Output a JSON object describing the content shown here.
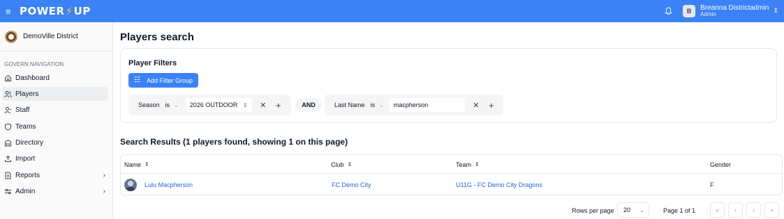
{
  "app": {
    "logo_left": "POWER",
    "logo_bolt": "⚡",
    "logo_right": "UP",
    "brand_color": "#3b82f6"
  },
  "user": {
    "initial": "B",
    "name": "Breanna Districtadmin",
    "role": "Admin"
  },
  "sidebar": {
    "district_name": "DemoVille District",
    "nav_title": "GOVERN NAVIGATION",
    "items": [
      {
        "label": "Dashboard",
        "icon": "home-icon"
      },
      {
        "label": "Players",
        "icon": "users-icon"
      },
      {
        "label": "Staff",
        "icon": "user-staff-icon"
      },
      {
        "label": "Teams",
        "icon": "shield-icon"
      },
      {
        "label": "Directory",
        "icon": "building-icon"
      },
      {
        "label": "Import",
        "icon": "upload-icon"
      },
      {
        "label": "Reports",
        "icon": "report-icon"
      },
      {
        "label": "Admin",
        "icon": "sliders-icon"
      }
    ]
  },
  "page": {
    "title": "Players search"
  },
  "filters": {
    "title": "Player Filters",
    "add_button": "Add Filter Group",
    "group1": {
      "field": "Season",
      "operator": "is",
      "value": "2026 OUTDOOR"
    },
    "connector": "AND",
    "group2": {
      "field": "Last Name",
      "operator": "is",
      "value": "macpherson"
    }
  },
  "results": {
    "title": "Search Results (1 players found, showing 1 on this page)",
    "columns": [
      "Name",
      "Club",
      "Team",
      "Gender"
    ],
    "rows": [
      {
        "name": "Lulu Macpherson",
        "club": "FC Demo City",
        "team": "U11G - FC Demo City Dragons",
        "gender": "F"
      }
    ]
  },
  "pagination": {
    "rows_per_page_label": "Rows per page",
    "rows_per_page": "20",
    "page_label": "Page 1 of 1"
  }
}
